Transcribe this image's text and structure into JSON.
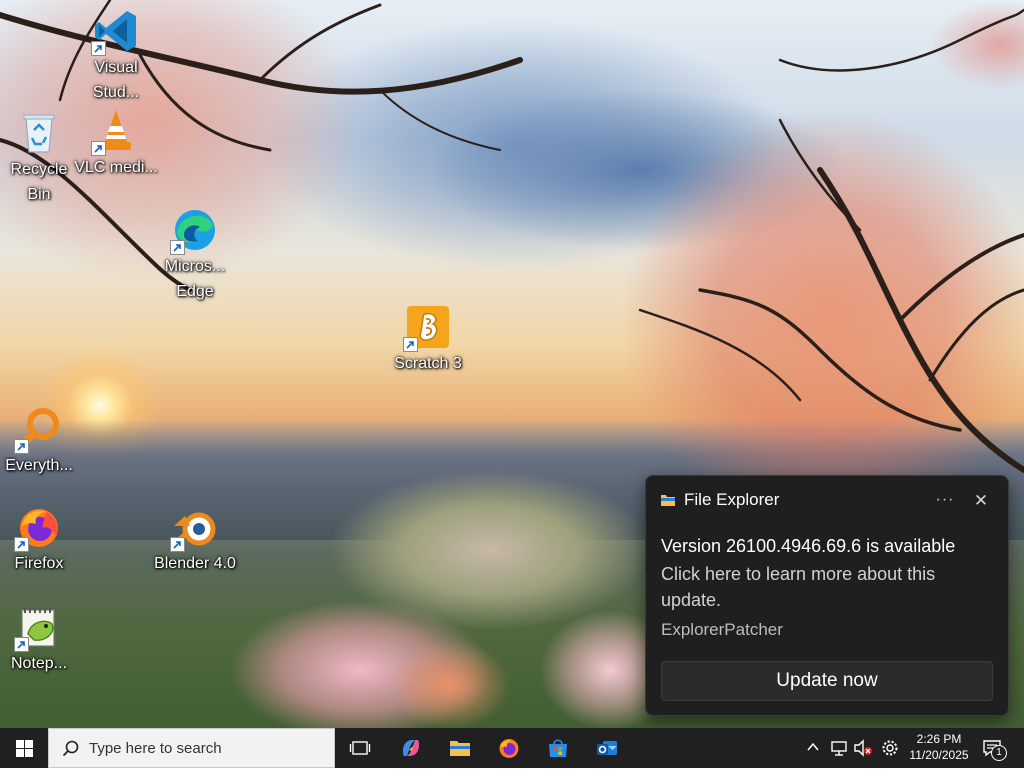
{
  "desktop": {
    "icons": [
      {
        "id": "vscode",
        "label": "Visual Stud...",
        "icon": "vscode-icon",
        "shortcut": true
      },
      {
        "id": "recycle",
        "label": "Recycle Bin",
        "icon": "recycle-bin-icon",
        "shortcut": false
      },
      {
        "id": "vlc",
        "label": "VLC medi...",
        "icon": "vlc-icon",
        "shortcut": true
      },
      {
        "id": "edge",
        "label": "Micros... Edge",
        "icon": "edge-icon",
        "shortcut": true
      },
      {
        "id": "scratch",
        "label": "Scratch 3",
        "icon": "scratch-icon",
        "shortcut": true
      },
      {
        "id": "everything",
        "label": "Everyth...",
        "icon": "everything-search-icon",
        "shortcut": true
      },
      {
        "id": "firefox",
        "label": "Firefox",
        "icon": "firefox-icon",
        "shortcut": true
      },
      {
        "id": "blender",
        "label": "Blender 4.0",
        "icon": "blender-icon",
        "shortcut": true
      },
      {
        "id": "notepad",
        "label": "Notep...",
        "icon": "notepad-plus-plus-icon",
        "shortcut": true
      }
    ]
  },
  "notification": {
    "app_name": "File Explorer",
    "title": "Version 26100.4946.69.6 is available",
    "body": "Click here to learn more about this update.",
    "attribution": "ExplorerPatcher",
    "action_label": "Update now",
    "more_label": "···",
    "close_label": "✕"
  },
  "taskbar": {
    "search_placeholder": "Type here to search",
    "pinned": [
      "task-view-icon",
      "copilot-icon",
      "file-explorer-icon",
      "firefox-icon",
      "microsoft-store-icon",
      "outlook-icon"
    ],
    "tray": {
      "time": "2:26 PM",
      "date": "11/20/2025",
      "notification_count": "1"
    }
  },
  "colors": {
    "taskbar_bg": "#202020",
    "toast_bg": "#1f1f1f",
    "search_bg": "#f2f2f2"
  }
}
